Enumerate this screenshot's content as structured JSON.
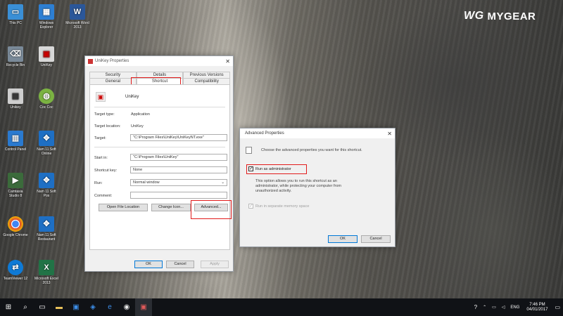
{
  "brand": {
    "name": "MYGEAR",
    "mark": "WG"
  },
  "desktop_icons": [
    {
      "label": "This PC",
      "color": "#3a8fd6",
      "glyph": "▭"
    },
    {
      "label": "Windows Explorer",
      "color": "#2d7fd3",
      "glyph": "▦"
    },
    {
      "label": "Microsoft Word 2013",
      "color": "#2b579a",
      "glyph": "W"
    },
    {
      "label": "Recycle Bin",
      "color": "#7a8a99",
      "glyph": "🗑"
    },
    {
      "label": "UniKey",
      "color": "#d8d8d8",
      "glyph": "▣"
    },
    {
      "label": "Unikey",
      "color": "#cfcfcf",
      "glyph": "▤"
    },
    {
      "label": "Coc Coc",
      "color": "#7bb342",
      "glyph": "◍"
    },
    {
      "label": "Control Panel",
      "color": "#2a7ad0",
      "glyph": "▥"
    },
    {
      "label": "Nam 11 Soft Online",
      "color": "#1e6fc4",
      "glyph": "✥"
    },
    {
      "label": "Camtasia Studio 8",
      "color": "#3b6b3b",
      "glyph": "▶"
    },
    {
      "label": "Nam 11 Soft Pos",
      "color": "#1e6fc4",
      "glyph": "✥"
    },
    {
      "label": "Google Chrome",
      "color": "#e8e8e8",
      "glyph": "◉"
    },
    {
      "label": "Nam 11 Soft Restaurant",
      "color": "#1e6fc4",
      "glyph": "✥"
    },
    {
      "label": "TeamViewer 12",
      "color": "#0e7ad6",
      "glyph": "⇄"
    },
    {
      "label": "Microsoft Excel 2013",
      "color": "#217346",
      "glyph": "X"
    }
  ],
  "props": {
    "title": "UniKey Properties",
    "close_glyph": "✕",
    "tabs_top": [
      "Security",
      "Details",
      "Previous Versions"
    ],
    "tabs_bottom": [
      "General",
      "Shortcut",
      "Compatibility"
    ],
    "app_name": "UniKey",
    "target_type_label": "Target type:",
    "target_type_value": "Application",
    "target_location_label": "Target location:",
    "target_location_value": "UniKey",
    "target_label": "Target:",
    "target_value": "\"C:\\Program Files\\UniKey\\UniKeyNT.exe\"",
    "start_in_label": "Start in:",
    "start_in_value": "\"C:\\Program Files\\UniKey\"",
    "shortcut_key_label": "Shortcut key:",
    "shortcut_key_value": "None",
    "run_label": "Run:",
    "run_value": "Normal window",
    "comment_label": "Comment:",
    "comment_value": "",
    "open_location": "Open File Location",
    "change_icon": "Change Icon...",
    "advanced": "Advanced...",
    "ok": "OK",
    "cancel": "Cancel",
    "apply": "Apply"
  },
  "adv": {
    "title": "Advanced Properties",
    "close_glyph": "✕",
    "intro": "Choose the advanced properties you want for this shortcut.",
    "run_as_admin": "Run as administrator",
    "run_as_admin_checked": true,
    "description": "This option allows you to run this shortcut as an administrator, while protecting your computer from unauthorized activity.",
    "separate_memory": "Run in separate memory space",
    "ok": "OK",
    "cancel": "Cancel"
  },
  "taskbar": {
    "time": "7:46 PM",
    "date": "04/01/2017",
    "lang": "ENG",
    "accent": "#e21b1b"
  }
}
